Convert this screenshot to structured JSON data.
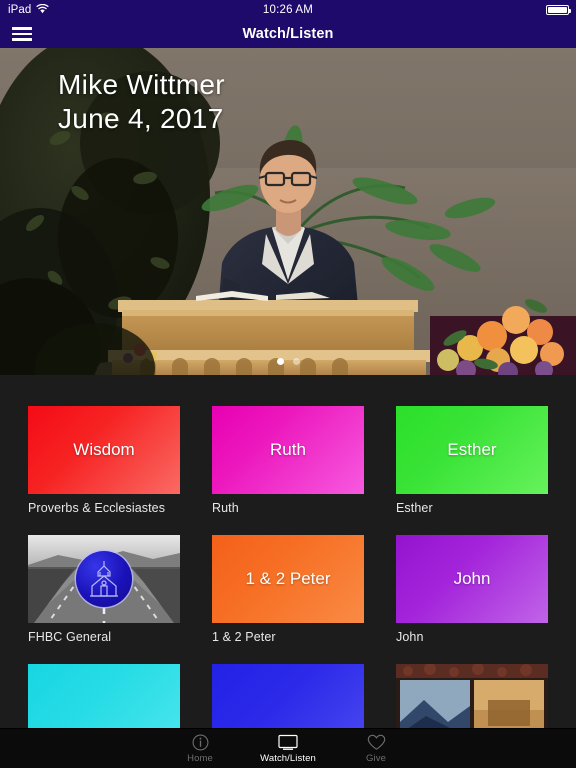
{
  "status_bar": {
    "device": "iPad",
    "wifi_icon": "wifi-icon",
    "time": "10:26 AM",
    "battery_icon": "battery-icon"
  },
  "nav_bar": {
    "menu_icon": "hamburger-menu-icon",
    "title": "Watch/Listen",
    "background_color": "#1d0a6b"
  },
  "hero": {
    "speaker": "Mike Wittmer",
    "date": "June 4, 2017",
    "page_dots": {
      "count": 2,
      "active_index": 0
    }
  },
  "series_grid": {
    "rows": [
      {
        "cells": [
          {
            "title": "Wisdom",
            "caption": "Proverbs & Ecclesiastes",
            "art": "t-wisdom",
            "name": "series-tile-wisdom"
          },
          {
            "title": "Ruth",
            "caption": "Ruth",
            "art": "t-ruth",
            "name": "series-tile-ruth"
          },
          {
            "title": "Esther",
            "caption": "Esther",
            "art": "t-esther",
            "name": "series-tile-esther"
          }
        ]
      },
      {
        "cells": [
          {
            "title": "",
            "caption": "FHBC General",
            "art": "t-general",
            "name": "series-tile-fhbc-general"
          },
          {
            "title": "1 & 2 Peter",
            "caption": "1 & 2 Peter",
            "art": "t-peter",
            "name": "series-tile-1-2-peter"
          },
          {
            "title": "John",
            "caption": "John",
            "art": "t-john",
            "name": "series-tile-john"
          }
        ]
      },
      {
        "cells": [
          {
            "title": "",
            "caption": "",
            "art": "t-cyan",
            "name": "series-tile-cyan"
          },
          {
            "title": "",
            "caption": "",
            "art": "t-blue",
            "name": "series-tile-blue"
          },
          {
            "title": "",
            "caption": "",
            "art": "t-photo",
            "name": "series-tile-photo"
          }
        ]
      }
    ]
  },
  "tab_bar": {
    "tabs": [
      {
        "label": "Home",
        "icon": "info-circle-icon",
        "active": false
      },
      {
        "label": "Watch/Listen",
        "icon": "tv-monitor-icon",
        "active": true
      },
      {
        "label": "Give",
        "icon": "heart-icon",
        "active": false
      }
    ]
  },
  "colors": {
    "nav_background": "#1d0a6b",
    "content_background": "#1c1c1c",
    "tabbar_background": "#0b0b0b",
    "accent_active": "#ffffff",
    "tab_inactive": "#6d6d6d"
  }
}
